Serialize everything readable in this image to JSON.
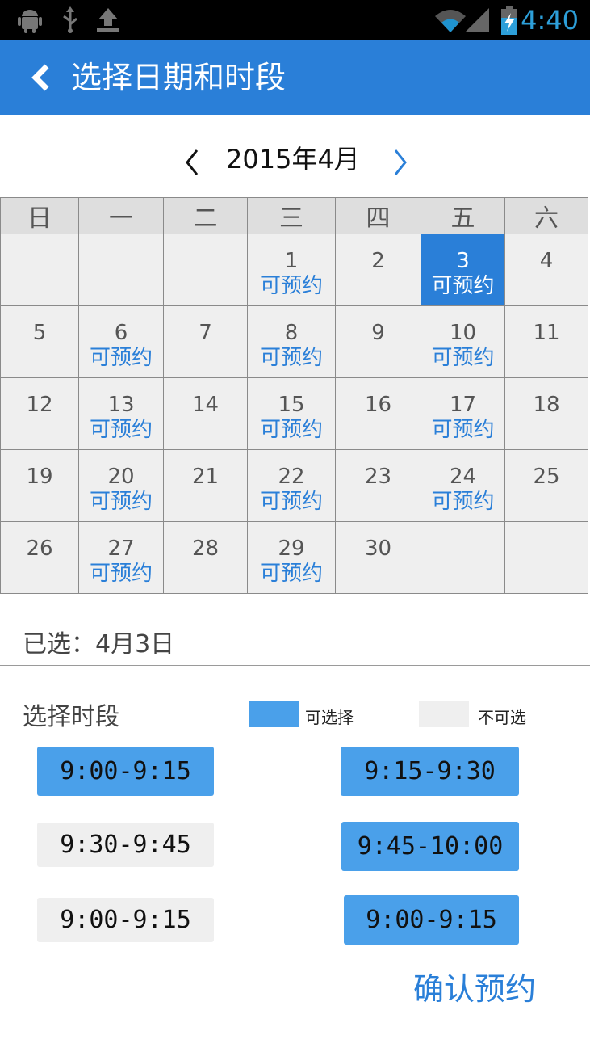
{
  "status_bar": {
    "left_icons": [
      "android-icon",
      "usb-icon",
      "upload-icon"
    ],
    "right_icons": [
      "wifi-icon",
      "signal-icon",
      "battery-charging-icon"
    ],
    "time": "4:40"
  },
  "app_bar": {
    "title": "选择日期和时段",
    "back_icon": "back-chevron-icon"
  },
  "calendar": {
    "month_label": "2015年4月",
    "weekdays": [
      "日",
      "一",
      "二",
      "三",
      "四",
      "五",
      "六"
    ],
    "available_label": "可预约",
    "weeks": [
      [
        {
          "day": ""
        },
        {
          "day": ""
        },
        {
          "day": ""
        },
        {
          "day": "1",
          "avail": true
        },
        {
          "day": "2"
        },
        {
          "day": "3",
          "avail": true,
          "selected": true
        },
        {
          "day": "4"
        }
      ],
      [
        {
          "day": "5"
        },
        {
          "day": "6",
          "avail": true
        },
        {
          "day": "7"
        },
        {
          "day": "8",
          "avail": true
        },
        {
          "day": "9"
        },
        {
          "day": "10",
          "avail": true
        },
        {
          "day": "11"
        }
      ],
      [
        {
          "day": "12"
        },
        {
          "day": "13",
          "avail": true
        },
        {
          "day": "14"
        },
        {
          "day": "15",
          "avail": true
        },
        {
          "day": "16"
        },
        {
          "day": "17",
          "avail": true
        },
        {
          "day": "18"
        }
      ],
      [
        {
          "day": "19"
        },
        {
          "day": "20",
          "avail": true
        },
        {
          "day": "21"
        },
        {
          "day": "22",
          "avail": true
        },
        {
          "day": "23"
        },
        {
          "day": "24",
          "avail": true
        },
        {
          "day": "25"
        }
      ],
      [
        {
          "day": "26"
        },
        {
          "day": "27",
          "avail": true
        },
        {
          "day": "28"
        },
        {
          "day": "29",
          "avail": true
        },
        {
          "day": "30"
        },
        {
          "day": ""
        },
        {
          "day": ""
        }
      ]
    ]
  },
  "selection": {
    "text": "已选：4月3日"
  },
  "time_slots": {
    "title": "选择时段",
    "legend": {
      "available": "可选择",
      "unavailable": "不可选"
    },
    "slots": [
      {
        "label": "9:00-9:15",
        "available": true
      },
      {
        "label": "9:15-9:30",
        "available": true
      },
      {
        "label": "9:30-9:45",
        "available": false
      },
      {
        "label": "9:45-10:00",
        "available": true
      },
      {
        "label": "9:00-9:15",
        "available": false
      },
      {
        "label": "9:00-9:15",
        "available": true
      }
    ]
  },
  "confirm_label": "确认预约",
  "colors": {
    "primary": "#2a7fd8",
    "slot_available": "#4aa0ea",
    "slot_unavailable": "#efefef",
    "cell_bg": "#efefef",
    "header_bg": "#dedede"
  }
}
